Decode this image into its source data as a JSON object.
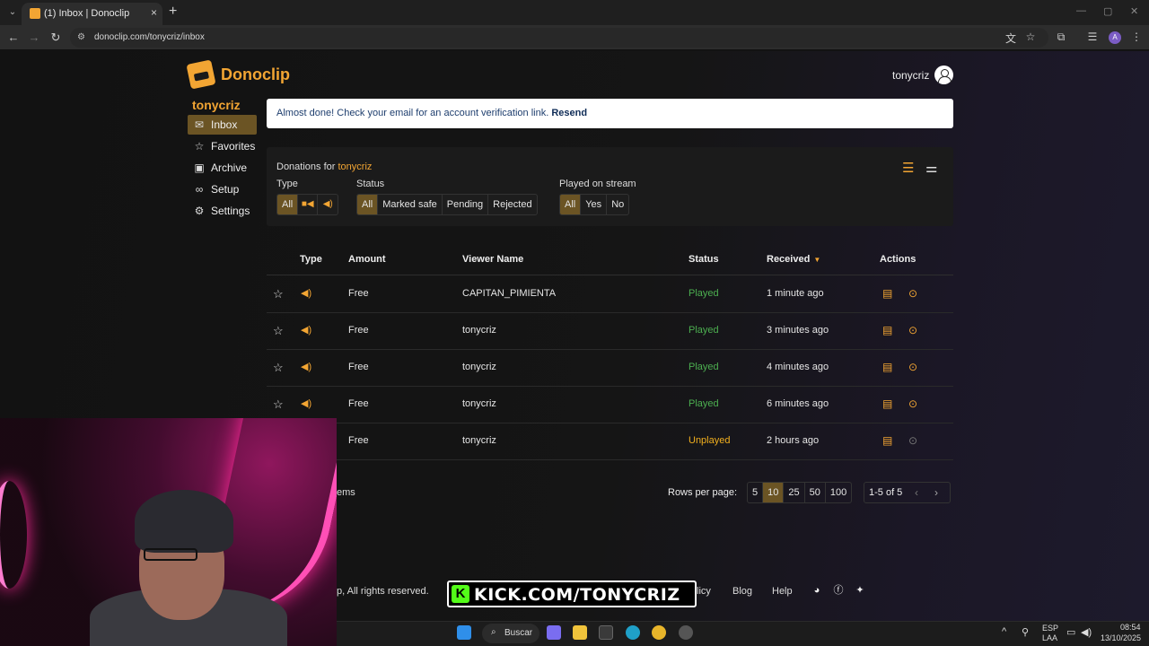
{
  "browser": {
    "tab_title": "(1) Inbox | Donoclip",
    "url": "donoclip.com/tonycriz/inbox"
  },
  "header": {
    "brand": "Donoclip",
    "username": "tonycriz"
  },
  "sidebar": {
    "user": "tonycriz",
    "items": [
      {
        "label": "Inbox",
        "icon": "inbox-icon"
      },
      {
        "label": "Favorites",
        "icon": "star-icon"
      },
      {
        "label": "Archive",
        "icon": "archive-icon"
      },
      {
        "label": "Setup",
        "icon": "link-icon"
      },
      {
        "label": "Settings",
        "icon": "gear-icon"
      }
    ]
  },
  "alert": {
    "message": "Almost done! Check your email for an account verification link.",
    "action": "Resend"
  },
  "filters": {
    "title_prefix": "Donations for",
    "title_user": "tonycriz",
    "type_label": "Type",
    "type_all": "All",
    "status_label": "Status",
    "status_options": [
      "All",
      "Marked safe",
      "Pending",
      "Rejected"
    ],
    "played_label": "Played on stream",
    "played_options": [
      "All",
      "Yes",
      "No"
    ]
  },
  "table": {
    "headers": {
      "type": "Type",
      "amount": "Amount",
      "viewer": "Viewer Name",
      "status": "Status",
      "received": "Received",
      "actions": "Actions"
    },
    "rows": [
      {
        "amount": "Free",
        "viewer": "CAPITAN_PIMIENTA",
        "status": "Played",
        "received": "1 minute ago"
      },
      {
        "amount": "Free",
        "viewer": "tonycriz",
        "status": "Played",
        "received": "3 minutes ago"
      },
      {
        "amount": "Free",
        "viewer": "tonycriz",
        "status": "Played",
        "received": "4 minutes ago"
      },
      {
        "amount": "Free",
        "viewer": "tonycriz",
        "status": "Played",
        "received": "6 minutes ago"
      },
      {
        "amount": "Free",
        "viewer": "tonycriz",
        "status": "Unplayed",
        "received": "2 hours ago"
      }
    ]
  },
  "pagination": {
    "items_fragment": "ems",
    "rows_per_page_label": "Rows per page:",
    "options": [
      "5",
      "10",
      "25",
      "50",
      "100"
    ],
    "selected": "10",
    "range": "1-5 of 5"
  },
  "footer": {
    "copyright_fragment": "p, All rights reserved.",
    "policy_fragment": "licy",
    "blog": "Blog",
    "help": "Help"
  },
  "overlay": {
    "kick_text": "KICK.COM/TONYCRIZ"
  },
  "taskbar": {
    "search": "Buscar",
    "lang_top": "ESP",
    "lang_bottom": "LAA",
    "time": "08:54",
    "date": "13/10/2025"
  },
  "colors": {
    "accent": "#f2a533",
    "active_bg": "#6b5424",
    "played": "#4caf50",
    "unplayed": "#f2b01e"
  }
}
